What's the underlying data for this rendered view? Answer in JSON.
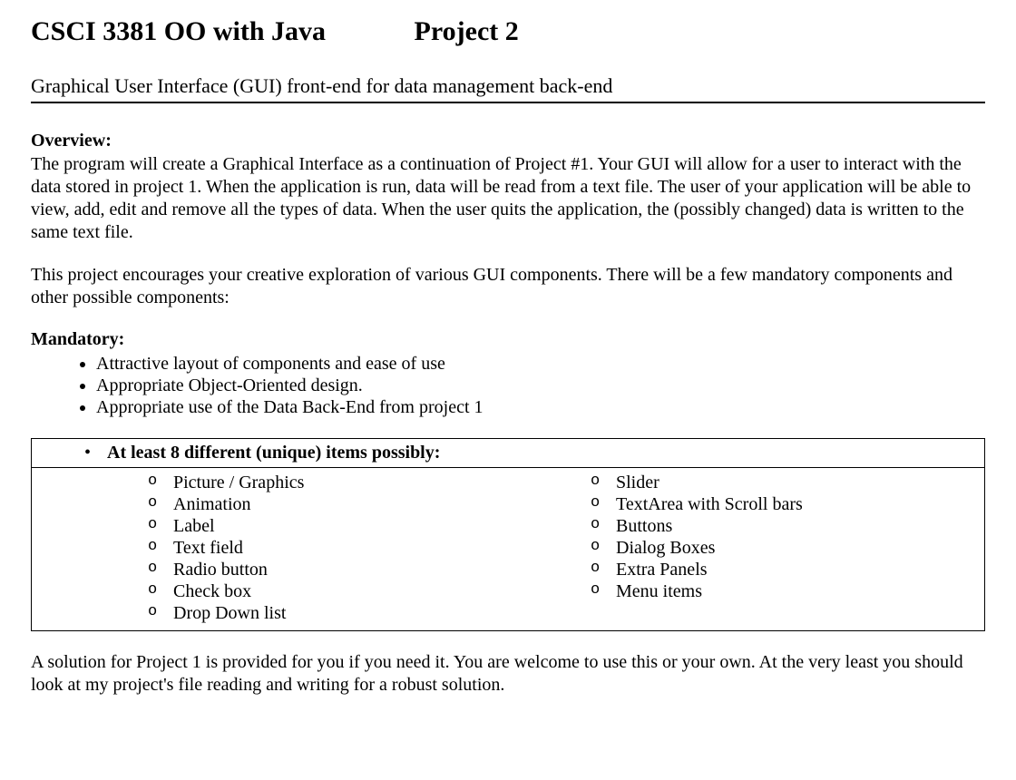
{
  "title": {
    "course": "CSCI 3381 OO with Java",
    "project": "Project 2"
  },
  "subtitle": "Graphical User Interface (GUI) front-end for data management back-end",
  "overview": {
    "heading": "Overview:",
    "p1": "The program will create a Graphical Interface as a continuation of Project #1.  Your GUI will allow for a user to interact with the data stored in project 1.  When the application is run, data will be read from a text file.  The user of your application will be able to view, add, edit and remove all the types of data.  When the user quits the application, the (possibly changed) data is written to the same text file.",
    "p2": "This project encourages your creative exploration of various GUI components.  There will be a few mandatory components and other possible components:"
  },
  "mandatory": {
    "heading": "Mandatory:",
    "items": [
      "Attractive layout of components and ease of use",
      "Appropriate Object-Oriented design.",
      "Appropriate use of the Data Back-End from project 1"
    ]
  },
  "box": {
    "header": "At least 8 different (unique) items possibly:",
    "left": [
      "Picture / Graphics",
      "Animation",
      "Label",
      "Text field",
      "Radio button",
      "Check box",
      "Drop Down list"
    ],
    "right": [
      "Slider",
      "TextArea with Scroll bars",
      "Buttons",
      "Dialog Boxes",
      "Extra Panels",
      "Menu items"
    ]
  },
  "footer": {
    "p1": "A solution for Project 1 is provided for you if you need it.  You are welcome to use this or your own. At the very least you should look at my project's file reading and writing for a robust solution."
  }
}
